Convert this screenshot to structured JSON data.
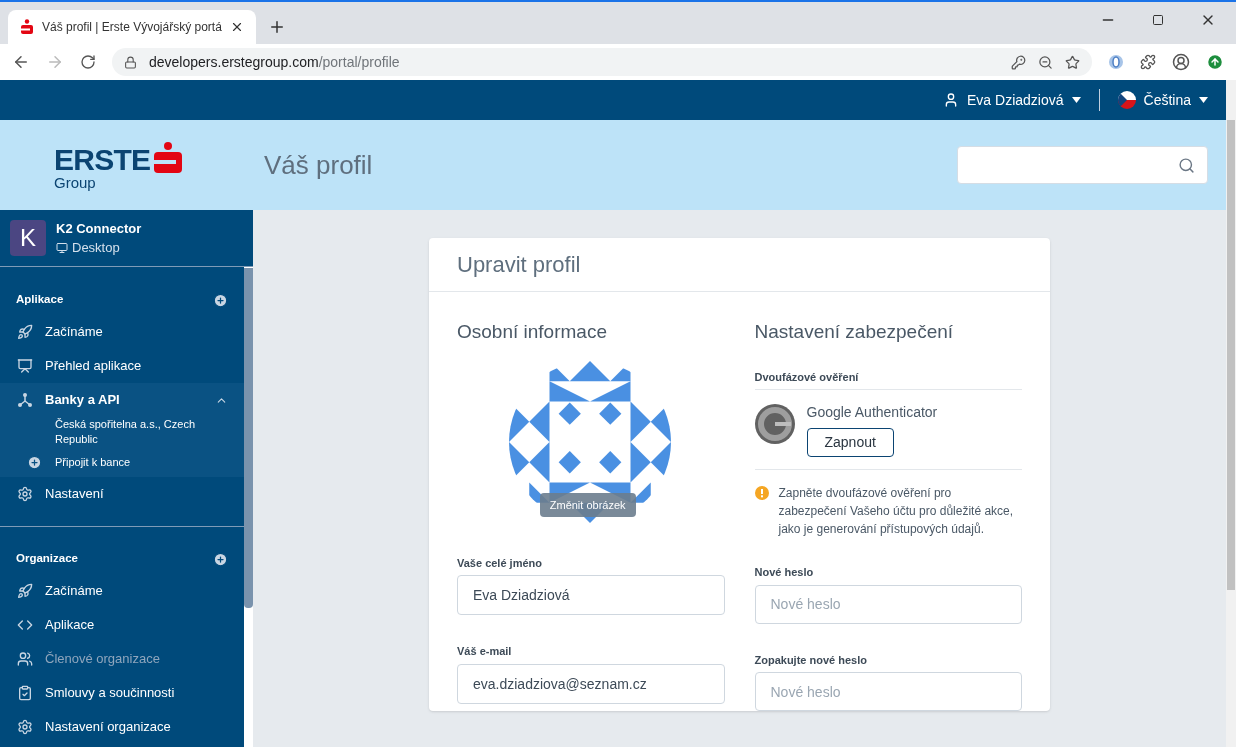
{
  "browser": {
    "tab_title": "Váš profil | Erste Vývojářský portá",
    "url_host": "developers.erstegroup.com",
    "url_path": "/portal/profile"
  },
  "topbar": {
    "user": "Eva Dziadziová",
    "language": "Čeština"
  },
  "header": {
    "logo_word": "ERSTE",
    "logo_sub": "Group",
    "page_title": "Váš profil"
  },
  "sidebar": {
    "app": {
      "initial": "K",
      "name": "K2 Connector",
      "type": "Desktop"
    },
    "sections": [
      {
        "title": "Aplikace",
        "items": [
          {
            "label": "Začínáme",
            "disabled": false
          },
          {
            "label": "Přehled aplikace",
            "disabled": false
          },
          {
            "label": "Banky a API",
            "disabled": false,
            "expanded": true,
            "children": [
              {
                "kind": "link",
                "label": "Česká spořitelna a.s., Czech Republic"
              },
              {
                "kind": "add",
                "label": "Připojit k bance"
              }
            ]
          },
          {
            "label": "Nastavení",
            "disabled": false
          }
        ]
      },
      {
        "title": "Organizace",
        "items": [
          {
            "label": "Začínáme",
            "disabled": false
          },
          {
            "label": "Aplikace",
            "disabled": false
          },
          {
            "label": "Členové organizace",
            "disabled": true
          },
          {
            "label": "Smlouvy a součinnosti",
            "disabled": false
          },
          {
            "label": "Nastavení organizace",
            "disabled": false
          }
        ]
      }
    ]
  },
  "card": {
    "title": "Upravit profil",
    "personal": {
      "heading": "Osobní informace",
      "change_picture": "Změnit obrázek",
      "fields": [
        {
          "label": "Vaše celé jméno",
          "value": "Eva Dziadziová"
        },
        {
          "label": "Váš e-mail",
          "value": "eva.dziadziova@seznam.cz"
        }
      ]
    },
    "security": {
      "heading": "Nastavení zabezpečení",
      "twofa_title": "Dvoufázové ověření",
      "authenticator": "Google Authenticator",
      "enable_button": "Zapnout",
      "warning": "Zapněte dvoufázové ověření pro zabezpečení Vašeho účtu pro důležité akce, jako je generování přístupových údajů.",
      "fields": [
        {
          "label": "Nové heslo",
          "placeholder": "Nové heslo"
        },
        {
          "label": "Zopakujte nové heslo",
          "placeholder": "Nové heslo"
        }
      ]
    }
  }
}
